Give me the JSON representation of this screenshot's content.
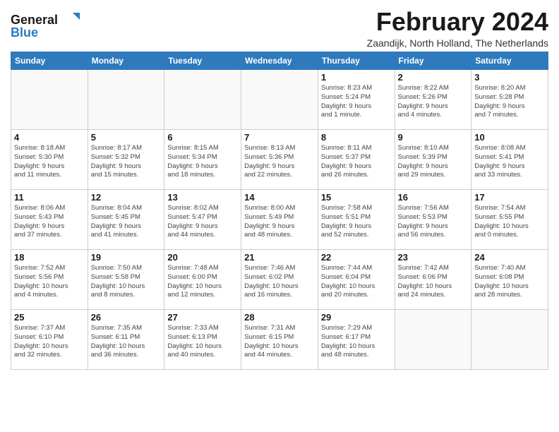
{
  "logo": {
    "line1": "General",
    "line2": "Blue"
  },
  "title": "February 2024",
  "subtitle": "Zaandijk, North Holland, The Netherlands",
  "weekdays": [
    "Sunday",
    "Monday",
    "Tuesday",
    "Wednesday",
    "Thursday",
    "Friday",
    "Saturday"
  ],
  "weeks": [
    [
      {
        "day": "",
        "info": ""
      },
      {
        "day": "",
        "info": ""
      },
      {
        "day": "",
        "info": ""
      },
      {
        "day": "",
        "info": ""
      },
      {
        "day": "1",
        "info": "Sunrise: 8:23 AM\nSunset: 5:24 PM\nDaylight: 9 hours\nand 1 minute."
      },
      {
        "day": "2",
        "info": "Sunrise: 8:22 AM\nSunset: 5:26 PM\nDaylight: 9 hours\nand 4 minutes."
      },
      {
        "day": "3",
        "info": "Sunrise: 8:20 AM\nSunset: 5:28 PM\nDaylight: 9 hours\nand 7 minutes."
      }
    ],
    [
      {
        "day": "4",
        "info": "Sunrise: 8:18 AM\nSunset: 5:30 PM\nDaylight: 9 hours\nand 11 minutes."
      },
      {
        "day": "5",
        "info": "Sunrise: 8:17 AM\nSunset: 5:32 PM\nDaylight: 9 hours\nand 15 minutes."
      },
      {
        "day": "6",
        "info": "Sunrise: 8:15 AM\nSunset: 5:34 PM\nDaylight: 9 hours\nand 18 minutes."
      },
      {
        "day": "7",
        "info": "Sunrise: 8:13 AM\nSunset: 5:36 PM\nDaylight: 9 hours\nand 22 minutes."
      },
      {
        "day": "8",
        "info": "Sunrise: 8:11 AM\nSunset: 5:37 PM\nDaylight: 9 hours\nand 26 minutes."
      },
      {
        "day": "9",
        "info": "Sunrise: 8:10 AM\nSunset: 5:39 PM\nDaylight: 9 hours\nand 29 minutes."
      },
      {
        "day": "10",
        "info": "Sunrise: 8:08 AM\nSunset: 5:41 PM\nDaylight: 9 hours\nand 33 minutes."
      }
    ],
    [
      {
        "day": "11",
        "info": "Sunrise: 8:06 AM\nSunset: 5:43 PM\nDaylight: 9 hours\nand 37 minutes."
      },
      {
        "day": "12",
        "info": "Sunrise: 8:04 AM\nSunset: 5:45 PM\nDaylight: 9 hours\nand 41 minutes."
      },
      {
        "day": "13",
        "info": "Sunrise: 8:02 AM\nSunset: 5:47 PM\nDaylight: 9 hours\nand 44 minutes."
      },
      {
        "day": "14",
        "info": "Sunrise: 8:00 AM\nSunset: 5:49 PM\nDaylight: 9 hours\nand 48 minutes."
      },
      {
        "day": "15",
        "info": "Sunrise: 7:58 AM\nSunset: 5:51 PM\nDaylight: 9 hours\nand 52 minutes."
      },
      {
        "day": "16",
        "info": "Sunrise: 7:56 AM\nSunset: 5:53 PM\nDaylight: 9 hours\nand 56 minutes."
      },
      {
        "day": "17",
        "info": "Sunrise: 7:54 AM\nSunset: 5:55 PM\nDaylight: 10 hours\nand 0 minutes."
      }
    ],
    [
      {
        "day": "18",
        "info": "Sunrise: 7:52 AM\nSunset: 5:56 PM\nDaylight: 10 hours\nand 4 minutes."
      },
      {
        "day": "19",
        "info": "Sunrise: 7:50 AM\nSunset: 5:58 PM\nDaylight: 10 hours\nand 8 minutes."
      },
      {
        "day": "20",
        "info": "Sunrise: 7:48 AM\nSunset: 6:00 PM\nDaylight: 10 hours\nand 12 minutes."
      },
      {
        "day": "21",
        "info": "Sunrise: 7:46 AM\nSunset: 6:02 PM\nDaylight: 10 hours\nand 16 minutes."
      },
      {
        "day": "22",
        "info": "Sunrise: 7:44 AM\nSunset: 6:04 PM\nDaylight: 10 hours\nand 20 minutes."
      },
      {
        "day": "23",
        "info": "Sunrise: 7:42 AM\nSunset: 6:06 PM\nDaylight: 10 hours\nand 24 minutes."
      },
      {
        "day": "24",
        "info": "Sunrise: 7:40 AM\nSunset: 6:08 PM\nDaylight: 10 hours\nand 28 minutes."
      }
    ],
    [
      {
        "day": "25",
        "info": "Sunrise: 7:37 AM\nSunset: 6:10 PM\nDaylight: 10 hours\nand 32 minutes."
      },
      {
        "day": "26",
        "info": "Sunrise: 7:35 AM\nSunset: 6:11 PM\nDaylight: 10 hours\nand 36 minutes."
      },
      {
        "day": "27",
        "info": "Sunrise: 7:33 AM\nSunset: 6:13 PM\nDaylight: 10 hours\nand 40 minutes."
      },
      {
        "day": "28",
        "info": "Sunrise: 7:31 AM\nSunset: 6:15 PM\nDaylight: 10 hours\nand 44 minutes."
      },
      {
        "day": "29",
        "info": "Sunrise: 7:29 AM\nSunset: 6:17 PM\nDaylight: 10 hours\nand 48 minutes."
      },
      {
        "day": "",
        "info": ""
      },
      {
        "day": "",
        "info": ""
      }
    ]
  ]
}
